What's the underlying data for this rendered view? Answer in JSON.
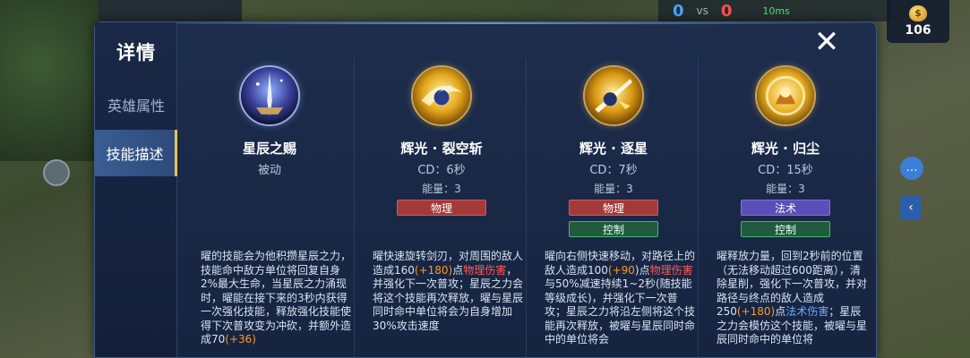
{
  "hud": {
    "score_blue": "0",
    "score_vs": "vs",
    "score_red": "0",
    "ping": "10ms",
    "gold_symbol": "$",
    "gold": "106"
  },
  "panel": {
    "title": "详情",
    "tabs": [
      {
        "label": "英雄属性",
        "active": false
      },
      {
        "label": "技能描述",
        "active": true
      }
    ],
    "close_label": "✕"
  },
  "skills": [
    {
      "name": "星辰之赐",
      "subtitle": "被动",
      "energy": "",
      "tags": [],
      "desc": [
        {
          "t": "曜的技能会为他积攒星辰之力，技能命中敌方单位将回复自身2%最大生命，当星辰之力涌现时，曜能在接下来的3秒内获得一次强化技能，释放强化技能使得下次普攻变为冲砍，并额外造成70",
          "c": ""
        },
        {
          "t": "(+36)",
          "c": "orange"
        }
      ]
    },
    {
      "name": "辉光 · 裂空斩",
      "subtitle": "CD：6秒",
      "energy": "能量：3",
      "tags": [
        {
          "label": "物理",
          "kind": "physical"
        }
      ],
      "desc": [
        {
          "t": "曜快速旋转剑刃，对周围的敌人造成160",
          "c": ""
        },
        {
          "t": "(+180)",
          "c": "orange"
        },
        {
          "t": "点",
          "c": ""
        },
        {
          "t": "物理伤害",
          "c": "red"
        },
        {
          "t": "，并强化下一次普攻；星辰之力会将这个技能再次释放，曜与星辰同时命中单位将会为自身增加30%攻击速度",
          "c": ""
        }
      ]
    },
    {
      "name": "辉光 · 逐星",
      "subtitle": "CD：7秒",
      "energy": "能量：3",
      "tags": [
        {
          "label": "物理",
          "kind": "physical"
        },
        {
          "label": "控制",
          "kind": "control"
        }
      ],
      "desc": [
        {
          "t": "曜向右侧快速移动，对路径上的敌人造成100",
          "c": ""
        },
        {
          "t": "(+90",
          "c": "orange"
        },
        {
          "t": ")点",
          "c": ""
        },
        {
          "t": "物理伤害",
          "c": "red"
        },
        {
          "t": "与50%减速持续1~2秒(随技能等级成长)，并强化下一次普攻；星辰之力将沿左侧将这个技能再次释放，被曜与星辰同时命中的单位将会",
          "c": ""
        }
      ]
    },
    {
      "name": "辉光 · 归尘",
      "subtitle": "CD：15秒",
      "energy": "能量：3",
      "tags": [
        {
          "label": "法术",
          "kind": "magic"
        },
        {
          "label": "控制",
          "kind": "control"
        }
      ],
      "desc": [
        {
          "t": "曜释放力量，回到2秒前的位置（无法移动超过600距离），清除星削，强化下一次普攻，并对路径与终点的敌人造成250",
          "c": ""
        },
        {
          "t": "(+180)",
          "c": "orange"
        },
        {
          "t": "点",
          "c": ""
        },
        {
          "t": "法术伤害",
          "c": "blue"
        },
        {
          "t": "；星辰之力会模仿这个技能，被曜与星辰同时命中的单位将",
          "c": ""
        }
      ]
    }
  ]
}
